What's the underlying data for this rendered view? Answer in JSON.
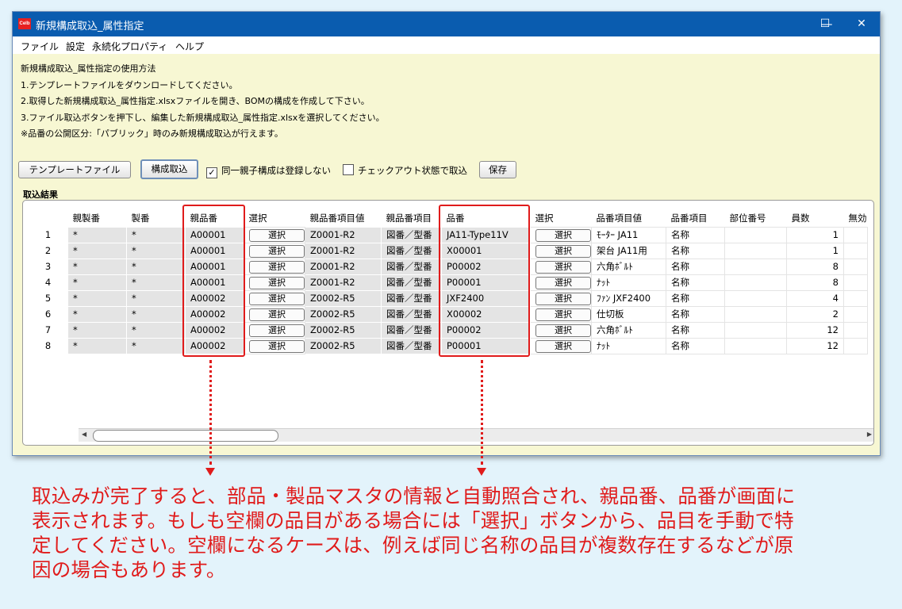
{
  "window": {
    "app_icon": "Celb",
    "title": "新規構成取込_属性指定",
    "controls": {
      "minimize": "—",
      "maximize": "☐",
      "close": "✕"
    }
  },
  "menu": [
    "ファイル",
    "設定",
    "永続化プロパティ",
    "ヘルプ"
  ],
  "instructions": [
    "新規構成取込_属性指定の使用方法",
    "1.テンプレートファイルをダウンロードしてください。",
    "2.取得した新規構成取込_属性指定.xlsxファイルを開き、BOMの構成を作成して下さい。",
    "3.ファイル取込ボタンを押下し、編集した新規構成取込_属性指定.xlsxを選択してください。",
    "※品番の公開区分:「パブリック」時のみ新規構成取込が行えます。"
  ],
  "toolbar": {
    "template_button": "テンプレートファイル",
    "import_button": "構成取込",
    "skip_same_parent_label": "同一親子構成は登録しない",
    "skip_same_parent_checked": true,
    "checkout_label": "チェックアウト状態で取込",
    "checkout_checked": false,
    "save_button": "保存"
  },
  "results_label": "取込結果",
  "table": {
    "headers": [
      "",
      "親製番",
      "製番",
      "親品番",
      "選択",
      "親品番項目値",
      "親品番項目",
      "品番",
      "選択",
      "品番項目値",
      "品番項目",
      "部位番号",
      "員数",
      "無効"
    ],
    "select_label": "選択",
    "rows": [
      {
        "no": "1",
        "parent_lot": "*",
        "lot": "*",
        "parent_part": "A00001",
        "parent_attr_value": "Z0001-R2",
        "parent_attr": "図番／型番",
        "part": "JA11-Type11V",
        "part_attr_value": "ﾓｰﾀｰ JA11",
        "part_attr": "名称",
        "position": "",
        "qty": "1"
      },
      {
        "no": "2",
        "parent_lot": "*",
        "lot": "*",
        "parent_part": "A00001",
        "parent_attr_value": "Z0001-R2",
        "parent_attr": "図番／型番",
        "part": "X00001",
        "part_attr_value": "架台 JA11用",
        "part_attr": "名称",
        "position": "",
        "qty": "1"
      },
      {
        "no": "3",
        "parent_lot": "*",
        "lot": "*",
        "parent_part": "A00001",
        "parent_attr_value": "Z0001-R2",
        "parent_attr": "図番／型番",
        "part": "P00002",
        "part_attr_value": "六角ﾎﾞﾙﾄ",
        "part_attr": "名称",
        "position": "",
        "qty": "8"
      },
      {
        "no": "4",
        "parent_lot": "*",
        "lot": "*",
        "parent_part": "A00001",
        "parent_attr_value": "Z0001-R2",
        "parent_attr": "図番／型番",
        "part": "P00001",
        "part_attr_value": "ﾅｯﾄ",
        "part_attr": "名称",
        "position": "",
        "qty": "8"
      },
      {
        "no": "5",
        "parent_lot": "*",
        "lot": "*",
        "parent_part": "A00002",
        "parent_attr_value": "Z0002-R5",
        "parent_attr": "図番／型番",
        "part": "JXF2400",
        "part_attr_value": "ﾌｧﾝ JXF2400",
        "part_attr": "名称",
        "position": "",
        "qty": "4"
      },
      {
        "no": "6",
        "parent_lot": "*",
        "lot": "*",
        "parent_part": "A00002",
        "parent_attr_value": "Z0002-R5",
        "parent_attr": "図番／型番",
        "part": "X00002",
        "part_attr_value": "仕切板",
        "part_attr": "名称",
        "position": "",
        "qty": "2"
      },
      {
        "no": "7",
        "parent_lot": "*",
        "lot": "*",
        "parent_part": "A00002",
        "parent_attr_value": "Z0002-R5",
        "parent_attr": "図番／型番",
        "part": "P00002",
        "part_attr_value": "六角ﾎﾞﾙﾄ",
        "part_attr": "名称",
        "position": "",
        "qty": "12"
      },
      {
        "no": "8",
        "parent_lot": "*",
        "lot": "*",
        "parent_part": "A00002",
        "parent_attr_value": "Z0002-R5",
        "parent_attr": "図番／型番",
        "part": "P00001",
        "part_attr_value": "ﾅｯﾄ",
        "part_attr": "名称",
        "position": "",
        "qty": "12"
      }
    ]
  },
  "annotation": {
    "color": "#e01b1b",
    "text": "取込みが完了すると、部品・製品マスタの情報と自動照合され、親品番、品番が画面に表示されます。もしも空欄の品目がある場合には「選択」ボタンから、品目を手動で特定してください。空欄になるケースは、例えば同じ名称の品目が複数存在するなどが原因の場合もあります。",
    "lines": [
      "取込みが完了すると、部品・製品マスタの情報と自動照合され、親品番、品番が画面に",
      "表示されます。もしも空欄の品目がある場合には「選択」ボタンから、品目を手動で特",
      "定してください。空欄になるケースは、例えば同じ名称の品目が複数存在するなどが原",
      "因の場合もあります。"
    ]
  }
}
